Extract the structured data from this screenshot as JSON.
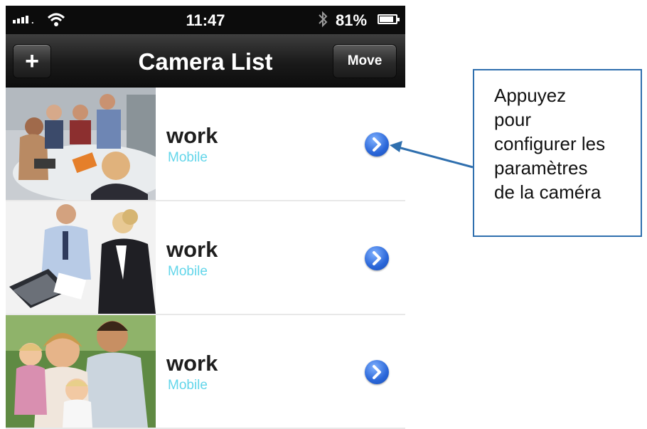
{
  "status_bar": {
    "time": "11:47",
    "battery_percent": "81%",
    "signal_icon": "signal-bars-icon",
    "wifi_icon": "wifi-icon",
    "bluetooth_icon": "bluetooth-icon",
    "battery_icon": "battery-icon",
    "battery_level": 0.81
  },
  "nav_bar": {
    "add_label": "+",
    "title": "Camera List",
    "move_label": "Move"
  },
  "cameras": [
    {
      "name": "work",
      "type": "Mobile",
      "thumbnail": "meeting-photo",
      "action_icon": "chevron-right-circle-icon"
    },
    {
      "name": "work",
      "type": "Mobile",
      "thumbnail": "business-people-laptop-photo",
      "action_icon": "chevron-right-circle-icon"
    },
    {
      "name": "work",
      "type": "Mobile",
      "thumbnail": "family-photo",
      "action_icon": "chevron-right-circle-icon"
    }
  ],
  "callout": {
    "text": "Appuyez\npour\nconfigurer les\nparamètres\nde la caméra"
  },
  "colors": {
    "status_bar_bg": "#0c0c0c",
    "nav_bar_bg": "#1a1a1a",
    "subtitle": "#63d6ea",
    "disclosure_blue": "#2a66d8",
    "callout_border": "#2f6fae"
  }
}
